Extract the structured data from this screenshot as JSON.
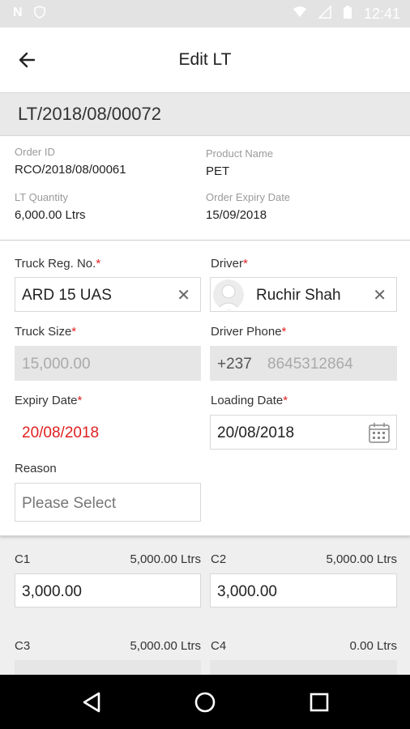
{
  "status_bar": {
    "time": "12:41"
  },
  "header": {
    "title": "Edit LT"
  },
  "lt_number": "LT/2018/08/00072",
  "info": {
    "order_id_label": "Order ID",
    "order_id": "RCO/2018/08/00061",
    "product_name_label": "Product Name",
    "product_name": "PET",
    "lt_quantity_label": "LT Quantity",
    "lt_quantity": "6,000.00 Ltrs",
    "order_expiry_label": "Order Expiry Date",
    "order_expiry": "15/09/2018"
  },
  "form": {
    "truck_reg_label": "Truck Reg. No.",
    "truck_reg_value": "ARD 15 UAS",
    "driver_label": "Driver",
    "driver_value": "Ruchir Shah",
    "truck_size_label": "Truck Size",
    "truck_size_value": "15,000.00",
    "driver_phone_label": "Driver Phone",
    "driver_phone_code": "+237",
    "driver_phone_value": "8645312864",
    "expiry_date_label": "Expiry Date",
    "expiry_date_value": "20/08/2018",
    "loading_date_label": "Loading Date",
    "loading_date_value": "20/08/2018",
    "reason_label": "Reason",
    "reason_placeholder": "Please Select",
    "required_mark": "*"
  },
  "compartments": [
    {
      "name": "C1",
      "capacity": "5,000.00 Ltrs",
      "value": "3,000.00"
    },
    {
      "name": "C2",
      "capacity": "5,000.00 Ltrs",
      "value": "3,000.00"
    },
    {
      "name": "C3",
      "capacity": "5,000.00 Ltrs",
      "value": ""
    },
    {
      "name": "C4",
      "capacity": "0.00 Ltrs",
      "value": ""
    }
  ],
  "colors": {
    "required": "#e02020",
    "expiry_value": "#e02020"
  },
  "icons": {
    "back": "arrow-left-icon",
    "clear": "close-icon",
    "calendar": "calendar-icon",
    "nav_back": "triangle-back-icon",
    "nav_home": "circle-home-icon",
    "nav_recent": "square-recent-icon"
  }
}
